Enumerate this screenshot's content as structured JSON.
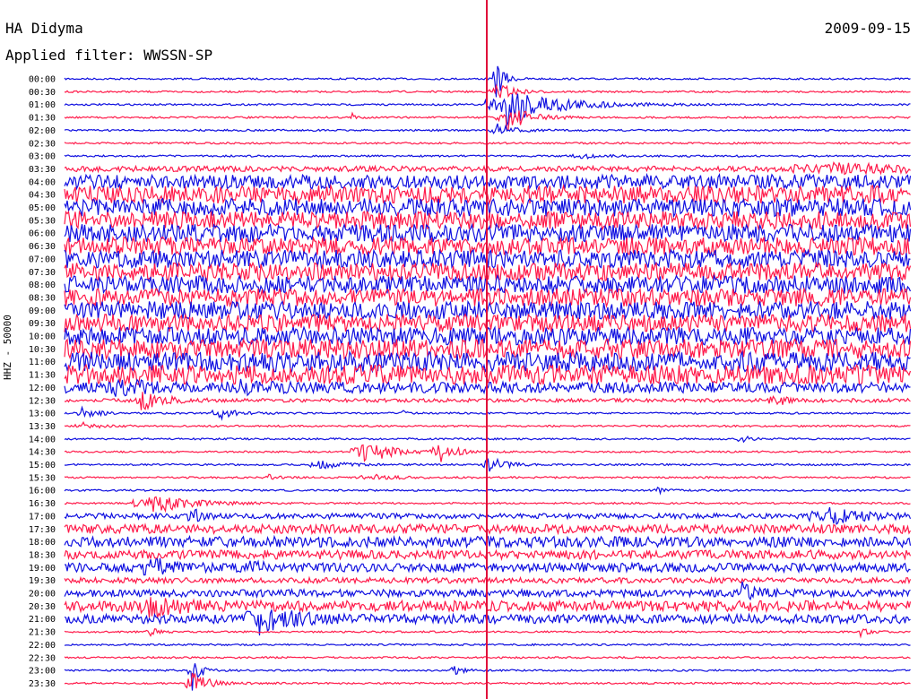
{
  "header": {
    "station": "HA Didyma",
    "date": "2009-09-15",
    "filter_label": "Applied filter: WWSSN-SP"
  },
  "chart_data": {
    "type": "line",
    "title": "HA Didyma",
    "subtitle": "Applied filter: WWSSN-SP",
    "date": "2009-09-15",
    "ylabel": "HHZ - 50000",
    "xlabel": "",
    "colors": [
      "#1010e0",
      "#ff1a4a"
    ],
    "marker_color": "#e0103a",
    "marker_x_fraction": 0.5,
    "rows": [
      {
        "label": "00:00",
        "amplitude": 1,
        "events": [
          {
            "x": 0.51,
            "amp": 25,
            "w": 0.01
          }
        ]
      },
      {
        "label": "00:30",
        "amplitude": 1,
        "events": [
          {
            "x": 0.51,
            "amp": 12,
            "w": 0.02
          }
        ]
      },
      {
        "label": "01:00",
        "amplitude": 1,
        "events": [
          {
            "x": 0.52,
            "amp": 26,
            "w": 0.06
          }
        ]
      },
      {
        "label": "01:30",
        "amplitude": 1,
        "events": [
          {
            "x": 0.34,
            "amp": 5,
            "w": 0.005
          },
          {
            "x": 0.52,
            "amp": 16,
            "w": 0.03
          }
        ]
      },
      {
        "label": "02:00",
        "amplitude": 1,
        "events": [
          {
            "x": 0.51,
            "amp": 8,
            "w": 0.02
          }
        ]
      },
      {
        "label": "02:30",
        "amplitude": 1,
        "events": []
      },
      {
        "label": "03:00",
        "amplitude": 1,
        "events": [
          {
            "x": 0.61,
            "amp": 3,
            "w": 0.03
          }
        ]
      },
      {
        "label": "03:30",
        "amplitude": 3,
        "events": [
          {
            "x": 0.9,
            "amp": 6,
            "w": 0.1
          }
        ]
      },
      {
        "label": "04:00",
        "amplitude": 8,
        "events": []
      },
      {
        "label": "04:30",
        "amplitude": 10,
        "events": []
      },
      {
        "label": "05:00",
        "amplitude": 10,
        "events": []
      },
      {
        "label": "05:30",
        "amplitude": 10,
        "events": []
      },
      {
        "label": "06:00",
        "amplitude": 10,
        "events": []
      },
      {
        "label": "06:30",
        "amplitude": 10,
        "events": []
      },
      {
        "label": "07:00",
        "amplitude": 10,
        "events": []
      },
      {
        "label": "07:30",
        "amplitude": 10,
        "events": []
      },
      {
        "label": "08:00",
        "amplitude": 10,
        "events": []
      },
      {
        "label": "08:30",
        "amplitude": 10,
        "events": []
      },
      {
        "label": "09:00",
        "amplitude": 10,
        "events": []
      },
      {
        "label": "09:30",
        "amplitude": 10,
        "events": []
      },
      {
        "label": "10:00",
        "amplitude": 10,
        "events": []
      },
      {
        "label": "10:30",
        "amplitude": 11,
        "events": []
      },
      {
        "label": "11:00",
        "amplitude": 11,
        "events": []
      },
      {
        "label": "11:30",
        "amplitude": 11,
        "events": []
      },
      {
        "label": "12:00",
        "amplitude": 6,
        "events": [
          {
            "x": 0.06,
            "amp": 8,
            "w": 0.03
          },
          {
            "x": 0.2,
            "amp": 6,
            "w": 0.03
          }
        ]
      },
      {
        "label": "12:30",
        "amplitude": 2,
        "events": [
          {
            "x": 0.09,
            "amp": 10,
            "w": 0.03
          },
          {
            "x": 0.84,
            "amp": 8,
            "w": 0.02
          }
        ]
      },
      {
        "label": "13:00",
        "amplitude": 1,
        "events": [
          {
            "x": 0.02,
            "amp": 6,
            "w": 0.02
          },
          {
            "x": 0.18,
            "amp": 8,
            "w": 0.02
          },
          {
            "x": 0.4,
            "amp": 3,
            "w": 0.005
          }
        ]
      },
      {
        "label": "13:30",
        "amplitude": 1,
        "events": [
          {
            "x": 0.02,
            "amp": 4,
            "w": 0.02
          }
        ]
      },
      {
        "label": "14:00",
        "amplitude": 1,
        "events": [
          {
            "x": 0.8,
            "amp": 6,
            "w": 0.01
          }
        ]
      },
      {
        "label": "14:30",
        "amplitude": 1,
        "events": [
          {
            "x": 0.35,
            "amp": 18,
            "w": 0.03
          },
          {
            "x": 0.44,
            "amp": 14,
            "w": 0.02
          }
        ]
      },
      {
        "label": "15:00",
        "amplitude": 1,
        "events": [
          {
            "x": 0.3,
            "amp": 6,
            "w": 0.03
          },
          {
            "x": 0.5,
            "amp": 10,
            "w": 0.02
          }
        ]
      },
      {
        "label": "15:30",
        "amplitude": 1,
        "events": [
          {
            "x": 0.24,
            "amp": 5,
            "w": 0.01
          },
          {
            "x": 0.36,
            "amp": 4,
            "w": 0.03
          }
        ]
      },
      {
        "label": "16:00",
        "amplitude": 1,
        "events": [
          {
            "x": 0.7,
            "amp": 4,
            "w": 0.01
          }
        ]
      },
      {
        "label": "16:30",
        "amplitude": 1,
        "events": [
          {
            "x": 0.1,
            "amp": 12,
            "w": 0.05
          }
        ]
      },
      {
        "label": "17:00",
        "amplitude": 3,
        "events": [
          {
            "x": 0.15,
            "amp": 10,
            "w": 0.01
          },
          {
            "x": 0.9,
            "amp": 8,
            "w": 0.05
          }
        ]
      },
      {
        "label": "17:30",
        "amplitude": 5,
        "events": []
      },
      {
        "label": "18:00",
        "amplitude": 6,
        "events": []
      },
      {
        "label": "18:30",
        "amplitude": 5,
        "events": []
      },
      {
        "label": "19:00",
        "amplitude": 5,
        "events": [
          {
            "x": 0.1,
            "amp": 12,
            "w": 0.02
          },
          {
            "x": 0.22,
            "amp": 10,
            "w": 0.01
          }
        ]
      },
      {
        "label": "19:30",
        "amplitude": 3,
        "events": []
      },
      {
        "label": "20:00",
        "amplitude": 4,
        "events": [
          {
            "x": 0.8,
            "amp": 10,
            "w": 0.02
          }
        ]
      },
      {
        "label": "20:30",
        "amplitude": 6,
        "events": [
          {
            "x": 0.1,
            "amp": 12,
            "w": 0.03
          }
        ]
      },
      {
        "label": "21:00",
        "amplitude": 5,
        "events": [
          {
            "x": 0.23,
            "amp": 14,
            "w": 0.04
          }
        ]
      },
      {
        "label": "21:30",
        "amplitude": 1,
        "events": [
          {
            "x": 0.1,
            "amp": 6,
            "w": 0.01
          },
          {
            "x": 0.94,
            "amp": 6,
            "w": 0.01
          }
        ]
      },
      {
        "label": "22:00",
        "amplitude": 1,
        "events": []
      },
      {
        "label": "22:30",
        "amplitude": 1,
        "events": []
      },
      {
        "label": "23:00",
        "amplitude": 1,
        "events": [
          {
            "x": 0.15,
            "amp": 25,
            "w": 0.01
          },
          {
            "x": 0.46,
            "amp": 8,
            "w": 0.01
          }
        ]
      },
      {
        "label": "23:30",
        "amplitude": 1,
        "events": [
          {
            "x": 0.15,
            "amp": 14,
            "w": 0.02
          }
        ]
      }
    ],
    "grid": false,
    "legend": "none"
  }
}
